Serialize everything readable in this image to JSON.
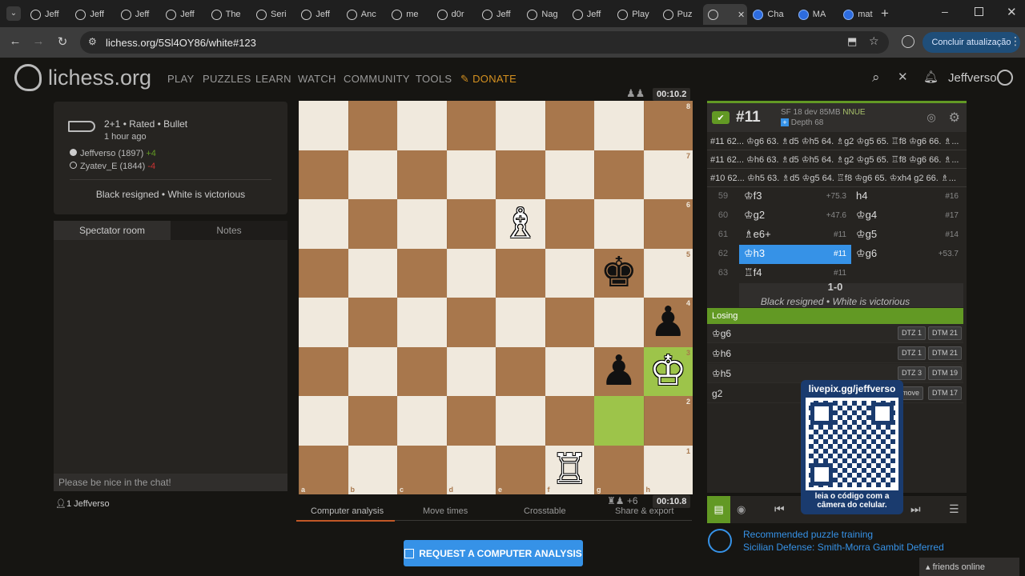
{
  "browser": {
    "tabs": [
      "Jeff",
      "Jeff",
      "Jeff",
      "Jeff",
      "The",
      "Seri",
      "Jeff",
      "Anc",
      "me",
      "d0r",
      "Jeff",
      "Nag",
      "Jeff",
      "Play",
      "Puz",
      "",
      "Cha",
      "MA",
      "mat"
    ],
    "active_tab_index": 15,
    "address": "lichess.org/5Sl4OY86/white#123",
    "update_button": "Concluir atualização"
  },
  "site": {
    "logo_text": "lichess.org",
    "nav": [
      "PLAY",
      "PUZZLES",
      "LEARN",
      "WATCH",
      "COMMUNITY",
      "TOOLS",
      "DONATE"
    ],
    "username": "Jeffverso"
  },
  "game": {
    "type": "2+1 • Rated • Bullet",
    "time_ago": "1 hour ago",
    "white_player": "Jeffverso (1897)",
    "white_diff": "+4",
    "black_player": "Zyatev_E (1844)",
    "black_diff": "-4",
    "result_text": "Black resigned • White is victorious"
  },
  "chat": {
    "tab_room": "Spectator room",
    "tab_notes": "Notes",
    "placeholder": "Please be nice in the chat!",
    "spectator_count": "1",
    "spectator_name": "Jeffverso"
  },
  "board": {
    "top_clock": "00:10.2",
    "bottom_clock": "00:10.8",
    "bottom_material": "+6",
    "files": [
      "a",
      "b",
      "c",
      "d",
      "e",
      "f",
      "g",
      "h"
    ],
    "ranks": [
      "8",
      "7",
      "6",
      "5",
      "4",
      "3",
      "2",
      "1"
    ],
    "pieces": [
      {
        "square": "e6",
        "glyph": "♗",
        "color": "white",
        "name": "white-bishop"
      },
      {
        "square": "g5",
        "glyph": "♚",
        "color": "black",
        "name": "black-king"
      },
      {
        "square": "h4",
        "glyph": "♟",
        "color": "black",
        "name": "black-pawn"
      },
      {
        "square": "g3",
        "glyph": "♟",
        "color": "black",
        "name": "black-pawn"
      },
      {
        "square": "h3",
        "glyph": "♔",
        "color": "white",
        "name": "white-king"
      },
      {
        "square": "f1",
        "glyph": "♖",
        "color": "white",
        "name": "white-rook"
      }
    ],
    "highlighted_squares": [
      "h3",
      "g2"
    ],
    "below_tabs": [
      "Computer analysis",
      "Move times",
      "Crosstable",
      "Share & export"
    ],
    "request_button": "REQUEST A COMPUTER ANALYSIS"
  },
  "analysis": {
    "rank": "#11",
    "engine": "SF 18 dev 85MB",
    "nnue": "NNUE",
    "depth": "Depth 68",
    "pv_lines": [
      "#11  62... ♔g6 63. ♗d5 ♔h5 64. ♗g2 ♔g5 65. ♖f8 ♔g6 66. ♗...",
      "#11  62... ♔h6 63. ♗d5 ♔h5 64. ♗g2 ♔g5 65. ♖f8 ♔g6 66. ♗...",
      "#10  62... ♔h5 63. ♗d5 ♔g5 64. ♖f8 ♔g6 65. ♔xh4 g2 66. ♗..."
    ],
    "moves": [
      {
        "n": "59",
        "w": "♔f3",
        "we": "+75.3",
        "b": "h4",
        "be": "#16"
      },
      {
        "n": "60",
        "w": "♔g2",
        "we": "+47.6",
        "b": "♔g4",
        "be": "#17"
      },
      {
        "n": "61",
        "w": "♗e6+",
        "we": "#11",
        "b": "♔g5",
        "be": "#14"
      },
      {
        "n": "62",
        "w": "♔h3",
        "we": "#11",
        "b": "♔g6",
        "be": "+53.7"
      },
      {
        "n": "63",
        "w": "♖f4",
        "we": "#11",
        "b": "",
        "be": ""
      }
    ],
    "score": "1-0",
    "result_text": "Black resigned • White is victorious",
    "tablebase_header": "Losing",
    "tablebase": [
      {
        "move": "♔g6",
        "dtz": "DTZ 1",
        "dtm": "DTM 21"
      },
      {
        "move": "♔h6",
        "dtz": "DTZ 1",
        "dtm": "DTM 21"
      },
      {
        "move": "♔h5",
        "dtz": "DTZ 3",
        "dtm": "DTM 19"
      },
      {
        "move": "g2",
        "dtz": "move",
        "dtm": "DTM 17"
      }
    ]
  },
  "overlay": {
    "livepix": "livepix.gg/jeffverso",
    "caption": "leia o código com a câmera do celular."
  },
  "footer": {
    "puzzle_title": "Recommended puzzle training",
    "puzzle_name": "Sicilian Defense: Smith-Morra Gambit Deferred",
    "friends": "friends online"
  },
  "colors": {
    "accent_green": "#629924",
    "accent_blue": "#3692e7",
    "donate": "#d59120"
  }
}
